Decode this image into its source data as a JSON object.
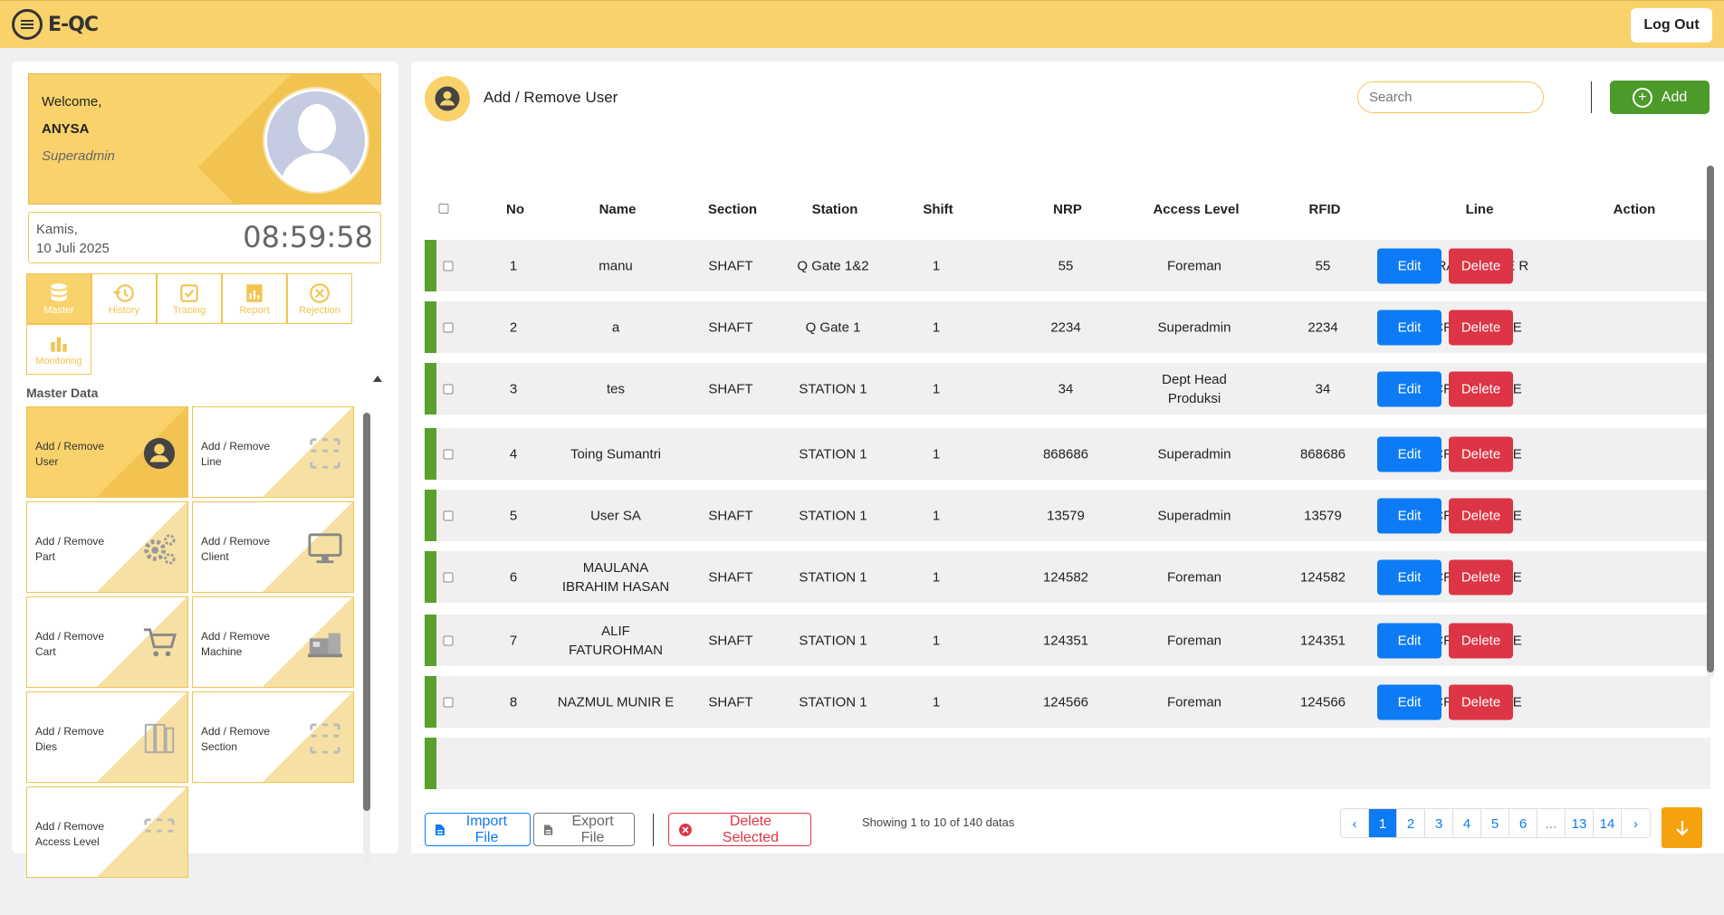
{
  "app": {
    "logo_text": "E-QC",
    "logout_label": "Log Out"
  },
  "profile": {
    "greeting": "Welcome,",
    "name": "ANYSA",
    "role": "Superadmin"
  },
  "datetime": {
    "day": "Kamis,",
    "date": "10 Juli 2025",
    "time": "08:59:58"
  },
  "tabs": [
    {
      "label": "Master",
      "icon": "database-icon"
    },
    {
      "label": "History",
      "icon": "history-icon"
    },
    {
      "label": "Tracing",
      "icon": "tracing-icon"
    },
    {
      "label": "Report",
      "icon": "report-icon"
    },
    {
      "label": "Rejection",
      "icon": "rejection-icon"
    },
    {
      "label": "Monitoring",
      "icon": "monitoring-icon"
    }
  ],
  "sidebar": {
    "section_title": "Master Data",
    "tiles": [
      {
        "label": "Add / Remove User",
        "icon": "user-icon"
      },
      {
        "label": "Add / Remove Line",
        "icon": "grid-icon"
      },
      {
        "label": "Add / Remove Part",
        "icon": "gears-icon"
      },
      {
        "label": "Add / Remove Client",
        "icon": "monitor-icon"
      },
      {
        "label": "Add / Remove Cart",
        "icon": "cart-icon"
      },
      {
        "label": "Add / Remove Machine",
        "icon": "machine-icon"
      },
      {
        "label": "Add / Remove Dies",
        "icon": "dies-icon"
      },
      {
        "label": "Add / Remove Section",
        "icon": "grid-icon"
      },
      {
        "label": "Add / Remove Access Level",
        "icon": "grid-icon"
      }
    ]
  },
  "main": {
    "title": "Add / Remove User",
    "search_placeholder": "Search",
    "add_label": "Add",
    "columns": [
      "No",
      "Name",
      "Section",
      "Station",
      "Shift",
      "NRP",
      "Access Level",
      "RFID",
      "Line",
      "Action"
    ],
    "rows": [
      {
        "no": "1",
        "name": "manu",
        "section": "SHAFT",
        "station": "Q Gate 1&2",
        "shift": "1",
        "nrp": "55",
        "access": "Foreman",
        "rfid": "55",
        "line": "CRANK CASE R"
      },
      {
        "no": "2",
        "name": "a",
        "section": "SHAFT",
        "station": "Q Gate 1",
        "shift": "1",
        "nrp": "2234",
        "access": "Superadmin",
        "rfid": "2234",
        "line": "CRANK CASE"
      },
      {
        "no": "3",
        "name": "tes",
        "section": "SHAFT",
        "station": "STATION 1",
        "shift": "1",
        "nrp": "34",
        "access": "Dept Head Produksi",
        "rfid": "34",
        "line": "CRANK CASE"
      },
      {
        "no": "4",
        "name": "Toing Sumantri",
        "section": "",
        "station": "STATION 1",
        "shift": "1",
        "nrp": "868686",
        "access": "Superadmin",
        "rfid": "868686",
        "line": "CRANK CASE"
      },
      {
        "no": "5",
        "name": "User SA",
        "section": "SHAFT",
        "station": "STATION 1",
        "shift": "1",
        "nrp": "13579",
        "access": "Superadmin",
        "rfid": "13579",
        "line": "CRANK CASE"
      },
      {
        "no": "6",
        "name": "MAULANA IBRAHIM HASAN",
        "section": "SHAFT",
        "station": "STATION 1",
        "shift": "1",
        "nrp": "124582",
        "access": "Foreman",
        "rfid": "124582",
        "line": "CRANK CASE"
      },
      {
        "no": "7",
        "name": "ALIF FATUROHMAN",
        "section": "SHAFT",
        "station": "STATION 1",
        "shift": "1",
        "nrp": "124351",
        "access": "Foreman",
        "rfid": "124351",
        "line": "CRANK CASE"
      },
      {
        "no": "8",
        "name": "NAZMUL MUNIR E",
        "section": "SHAFT",
        "station": "STATION 1",
        "shift": "1",
        "nrp": "124566",
        "access": "Foreman",
        "rfid": "124566",
        "line": "CRANK CASE"
      }
    ],
    "edit_label": "Edit",
    "delete_label": "Delete"
  },
  "footer": {
    "import_label": "Import File",
    "export_label": "Export File",
    "delete_selected_label": "Delete Selected",
    "showing": "Showing 1 to 10 of 140 datas",
    "pages": [
      "‹",
      "1",
      "2",
      "3",
      "4",
      "5",
      "6",
      "...",
      "13",
      "14",
      "›"
    ],
    "active_page": "1"
  },
  "colors": {
    "accent": "#f9d26b",
    "green": "#5aa02c",
    "blue": "#0d7bf5",
    "red": "#dc3545"
  }
}
